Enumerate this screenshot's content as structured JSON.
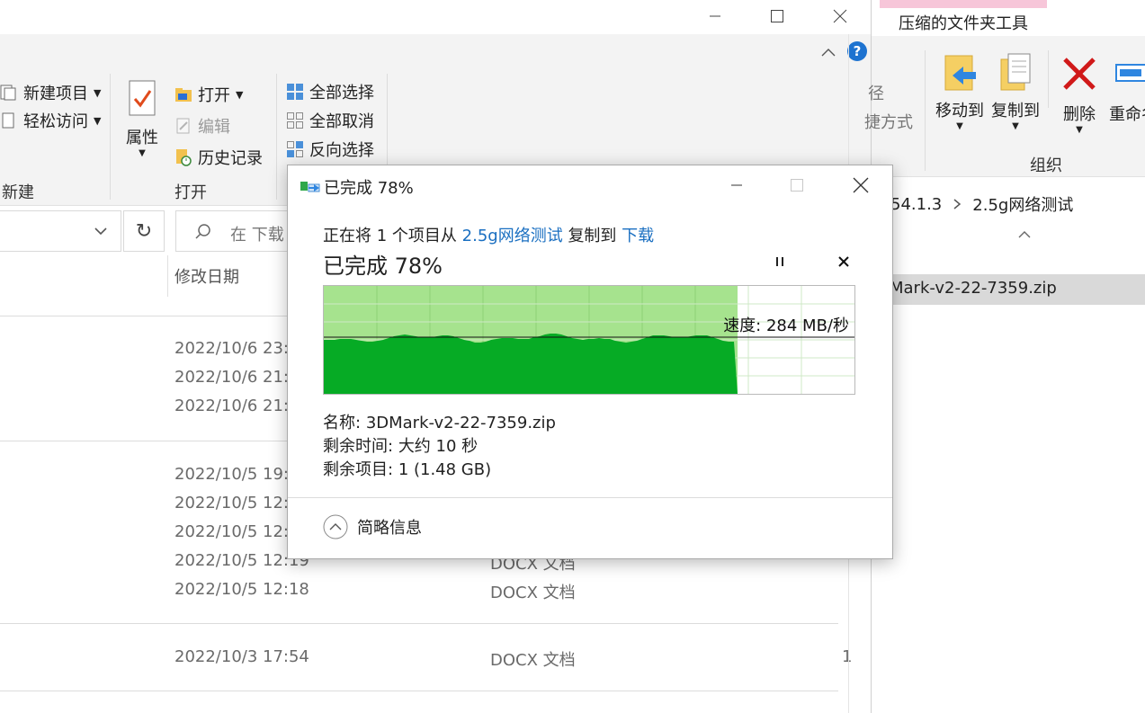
{
  "left_window": {
    "ribbon": {
      "new_item": "新建项目",
      "easy_access": "轻松访问",
      "new_group": "新建",
      "properties": "属性",
      "open": "打开",
      "edit": "编辑",
      "history": "历史记录",
      "open_group": "打开",
      "select_all": "全部选择",
      "select_none": "全部取消",
      "invert_selection": "反向选择"
    },
    "search_placeholder": "在 下载",
    "column_modified": "修改日期",
    "dates": [
      "2022/10/6 23:",
      "2022/10/6 21:",
      "2022/10/6 21:",
      "2022/10/5 19:",
      "2022/10/5 12:",
      "2022/10/5 12:",
      "2022/10/5 12:19",
      "2022/10/5 12:18",
      "2022/10/3 17:54"
    ],
    "types": [
      "DOCX 文档",
      "DOCX 文档",
      "DOCX 文档"
    ],
    "size_fragment": "1"
  },
  "right_window": {
    "tab_label": "压缩的文件夹工具",
    "partial_path_label": "径",
    "partial_shortcut_label": "捷方式",
    "move_to": "移动到",
    "copy_to": "复制到",
    "delete": "删除",
    "rename": "重命名",
    "organize_group": "组织",
    "address_fragment": "54.1.3",
    "address_folder": "2.5g网络测试",
    "selected_file": "Mark-v2-22-7359.zip"
  },
  "dialog": {
    "title": "已完成 78%",
    "progress_percent": 78,
    "line_prefix": "正在将 1 个项目从",
    "source": "2.5g网络测试",
    "copy_to_word": "复制到",
    "destination": "下载",
    "heading": "已完成 78%",
    "speed": "速度: 284 MB/秒",
    "name_label": "名称:",
    "name_value": "3DMark-v2-22-7359.zip",
    "time_label": "剩余时间:",
    "time_value": "大约 10 秒",
    "items_label": "剩余项目:",
    "items_value": "1 (1.48 GB)",
    "less_details": "简略信息"
  },
  "colors": {
    "graph_fill": "#06ab25",
    "graph_background": "#a6e38e",
    "link": "#1a6fc1",
    "help": "#1e73d0",
    "delete_red": "#d01919",
    "tab_pink": "#f7c6d9"
  }
}
